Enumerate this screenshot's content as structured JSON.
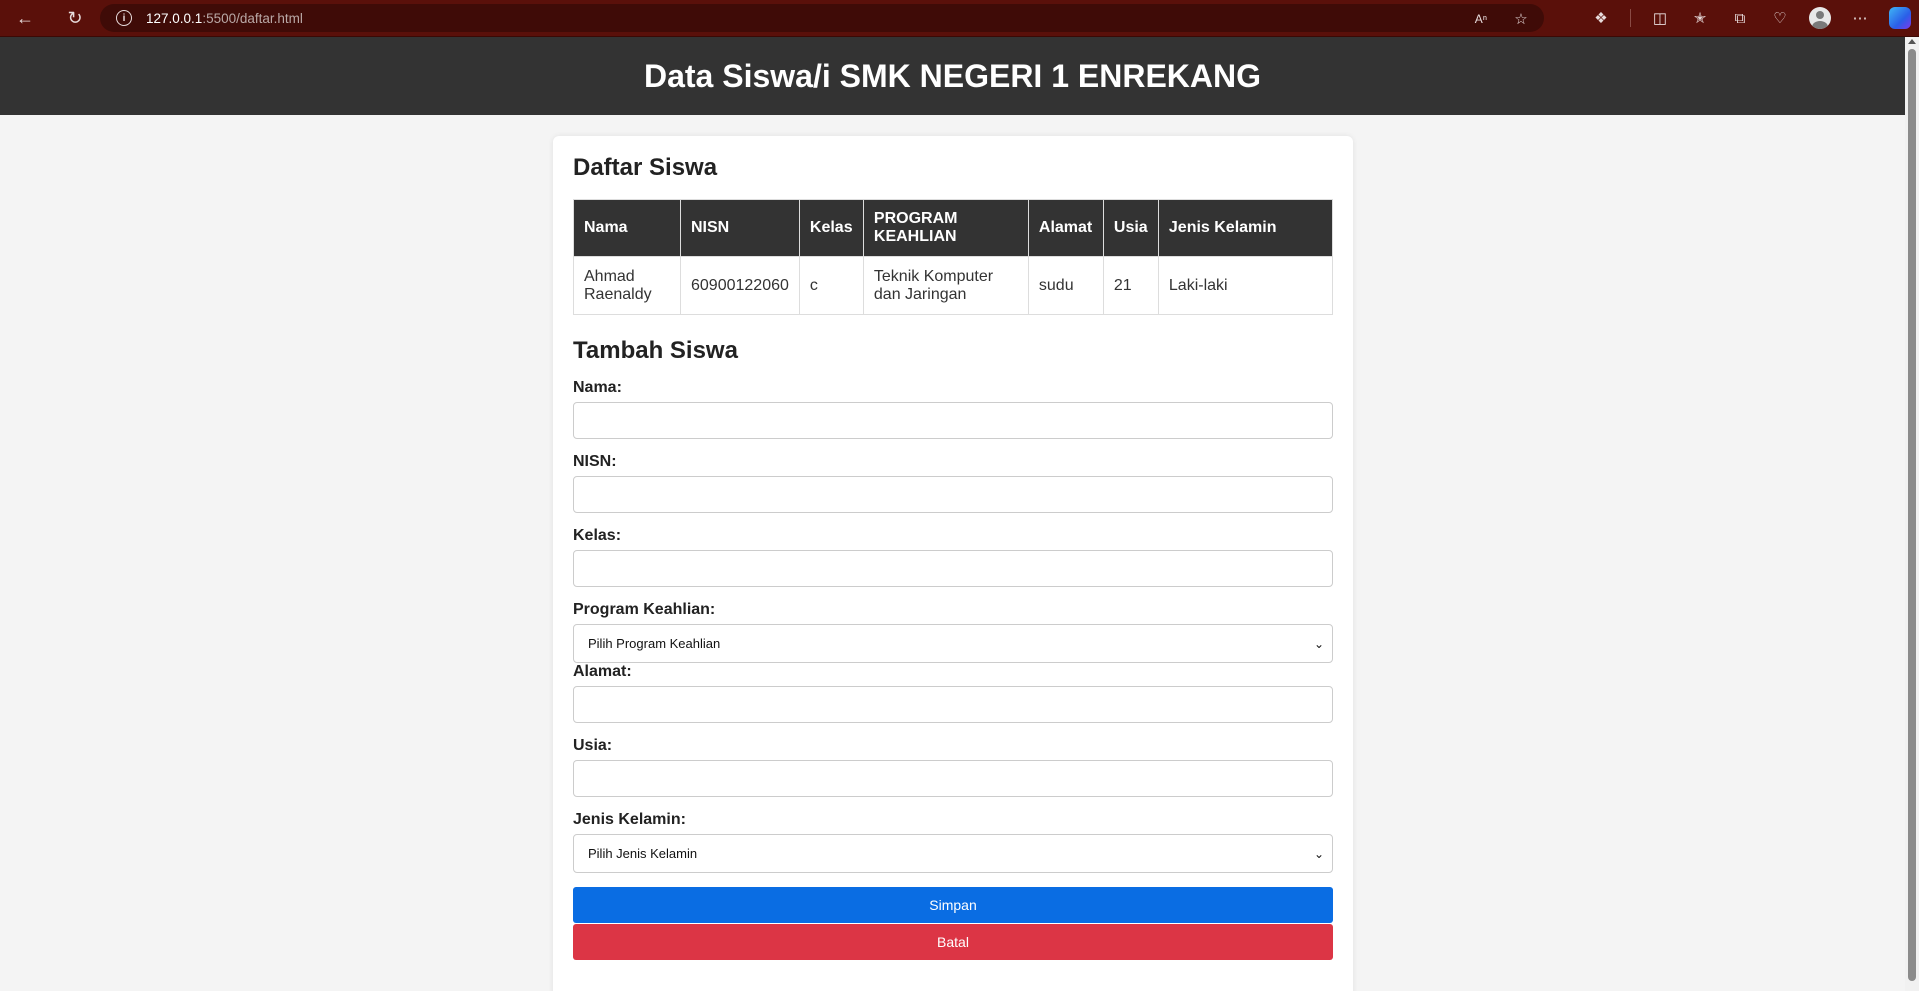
{
  "browser": {
    "url_host": "127.0.0.1",
    "url_path": ":5500/daftar.html"
  },
  "header": {
    "title": "Data Siswa/i SMK NEGERI 1 ENREKANG"
  },
  "list": {
    "title": "Daftar Siswa",
    "columns": [
      "Nama",
      "NISN",
      "Kelas",
      "PROGRAM KEAHLIAN",
      "Alamat",
      "Usia",
      "Jenis Kelamin"
    ],
    "rows": [
      [
        "Ahmad Raenaldy",
        "60900122060",
        "c",
        "Teknik Komputer dan Jaringan",
        "sudu",
        "21",
        "Laki-laki"
      ]
    ]
  },
  "form": {
    "title": "Tambah Siswa",
    "nama_label": "Nama:",
    "nisn_label": "NISN:",
    "kelas_label": "Kelas:",
    "program_label": "Program Keahlian:",
    "program_selected": "Pilih Program Keahlian",
    "alamat_label": "Alamat:",
    "usia_label": "Usia:",
    "gender_label": "Jenis Kelamin:",
    "gender_selected": "Pilih Jenis Kelamin",
    "save_label": "Simpan",
    "cancel_label": "Batal"
  },
  "colors": {
    "header_bg": "#333333",
    "save_button": "#0a6de3",
    "cancel_button": "#dc3545",
    "browser_chrome": "#5a100a"
  }
}
